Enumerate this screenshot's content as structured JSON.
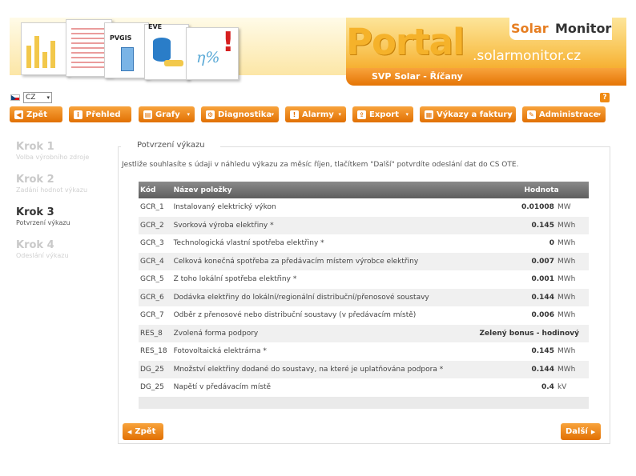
{
  "header": {
    "portal": "Portal",
    "domain": ".solarmonitor.cz",
    "brand_solar": "Solar",
    "brand_monitor": "Monitor",
    "project": "SVP Solar - Říčany",
    "doc_tag_pvgis": "PVGIS",
    "doc_tag_eve": "EVE",
    "pct": "η%",
    "exclaim": "!"
  },
  "language": {
    "selected": "CZ",
    "arrow": "▾"
  },
  "help": {
    "label": "?"
  },
  "toolbar": [
    {
      "label": "Zpět",
      "icon": "arrow-left-icon",
      "glyph": "◀"
    },
    {
      "label": "Přehled",
      "icon": "info-icon",
      "glyph": "i"
    },
    {
      "label": "Grafy",
      "icon": "chart-icon",
      "glyph": "▤"
    },
    {
      "label": "Diagnostika",
      "icon": "wrench-icon",
      "glyph": "⚙"
    },
    {
      "label": "Alarmy",
      "icon": "alarm-icon",
      "glyph": "!"
    },
    {
      "label": "Export",
      "icon": "export-icon",
      "glyph": "⇪"
    },
    {
      "label": "Výkazy a faktury",
      "icon": "printer-icon",
      "glyph": "▦"
    },
    {
      "label": "Administrace",
      "icon": "admin-icon",
      "glyph": "✎"
    }
  ],
  "dropdown_glyph": "▾",
  "steps": [
    {
      "title": "Krok 1",
      "sub": "Volba výrobního zdroje"
    },
    {
      "title": "Krok 2",
      "sub": "Zadání hodnot výkazu"
    },
    {
      "title": "Krok 3",
      "sub": "Potvrzení výkazu"
    },
    {
      "title": "Krok 4",
      "sub": "Odeslání výkazu"
    }
  ],
  "panel": {
    "legend": "Potvrzení výkazu",
    "intro": "Jestliže souhlasíte s údaji v náhledu výkazu za měsíc říjen, tlačítkem \"Další\" potvrdíte odeslání dat do CS OTE."
  },
  "table": {
    "headers": {
      "code": "Kód",
      "name": "Název položky",
      "value": "Hodnota"
    },
    "rows": [
      {
        "code": "GCR_1",
        "name": "Instalovaný elektrický výkon",
        "value": "0.01008",
        "unit": "MW"
      },
      {
        "code": "GCR_2",
        "name": "Svorková výroba elektřiny *",
        "value": "0.145",
        "unit": "MWh"
      },
      {
        "code": "GCR_3",
        "name": "Technologická vlastní spotřeba elektřiny *",
        "value": "0",
        "unit": "MWh"
      },
      {
        "code": "GCR_4",
        "name": "Celková konečná spotřeba za předávacím místem výrobce elektřiny",
        "value": "0.007",
        "unit": "MWh"
      },
      {
        "code": "GCR_5",
        "name": "Z toho lokální spotřeba elektřiny *",
        "value": "0.001",
        "unit": "MWh"
      },
      {
        "code": "GCR_6",
        "name": "Dodávka elektřiny do lokální/regionální distribuční/přenosové soustavy",
        "value": "0.144",
        "unit": "MWh"
      },
      {
        "code": "GCR_7",
        "name": "Odběr z přenosové nebo distribuční soustavy (v předávacím místě)",
        "value": "0.006",
        "unit": "MWh"
      },
      {
        "code": "RES_8",
        "name": "Zvolená forma podpory",
        "value": "Zelený bonus - hodinový",
        "unit": ""
      },
      {
        "code": "RES_18",
        "name": "Fotovoltaická elektrárna *",
        "value": "0.145",
        "unit": "MWh"
      },
      {
        "code": "DG_25",
        "name": "Množství elektřiny dodané do soustavy, na které je uplatňována podpora *",
        "value": "0.144",
        "unit": "MWh"
      },
      {
        "code": "DG_25",
        "name": "Napětí v předávacím místě",
        "value": "0.4",
        "unit": "kV"
      }
    ]
  },
  "buttons": {
    "back": "Zpět",
    "next": "Další",
    "back_glyph": "◀",
    "next_glyph": "▶"
  }
}
